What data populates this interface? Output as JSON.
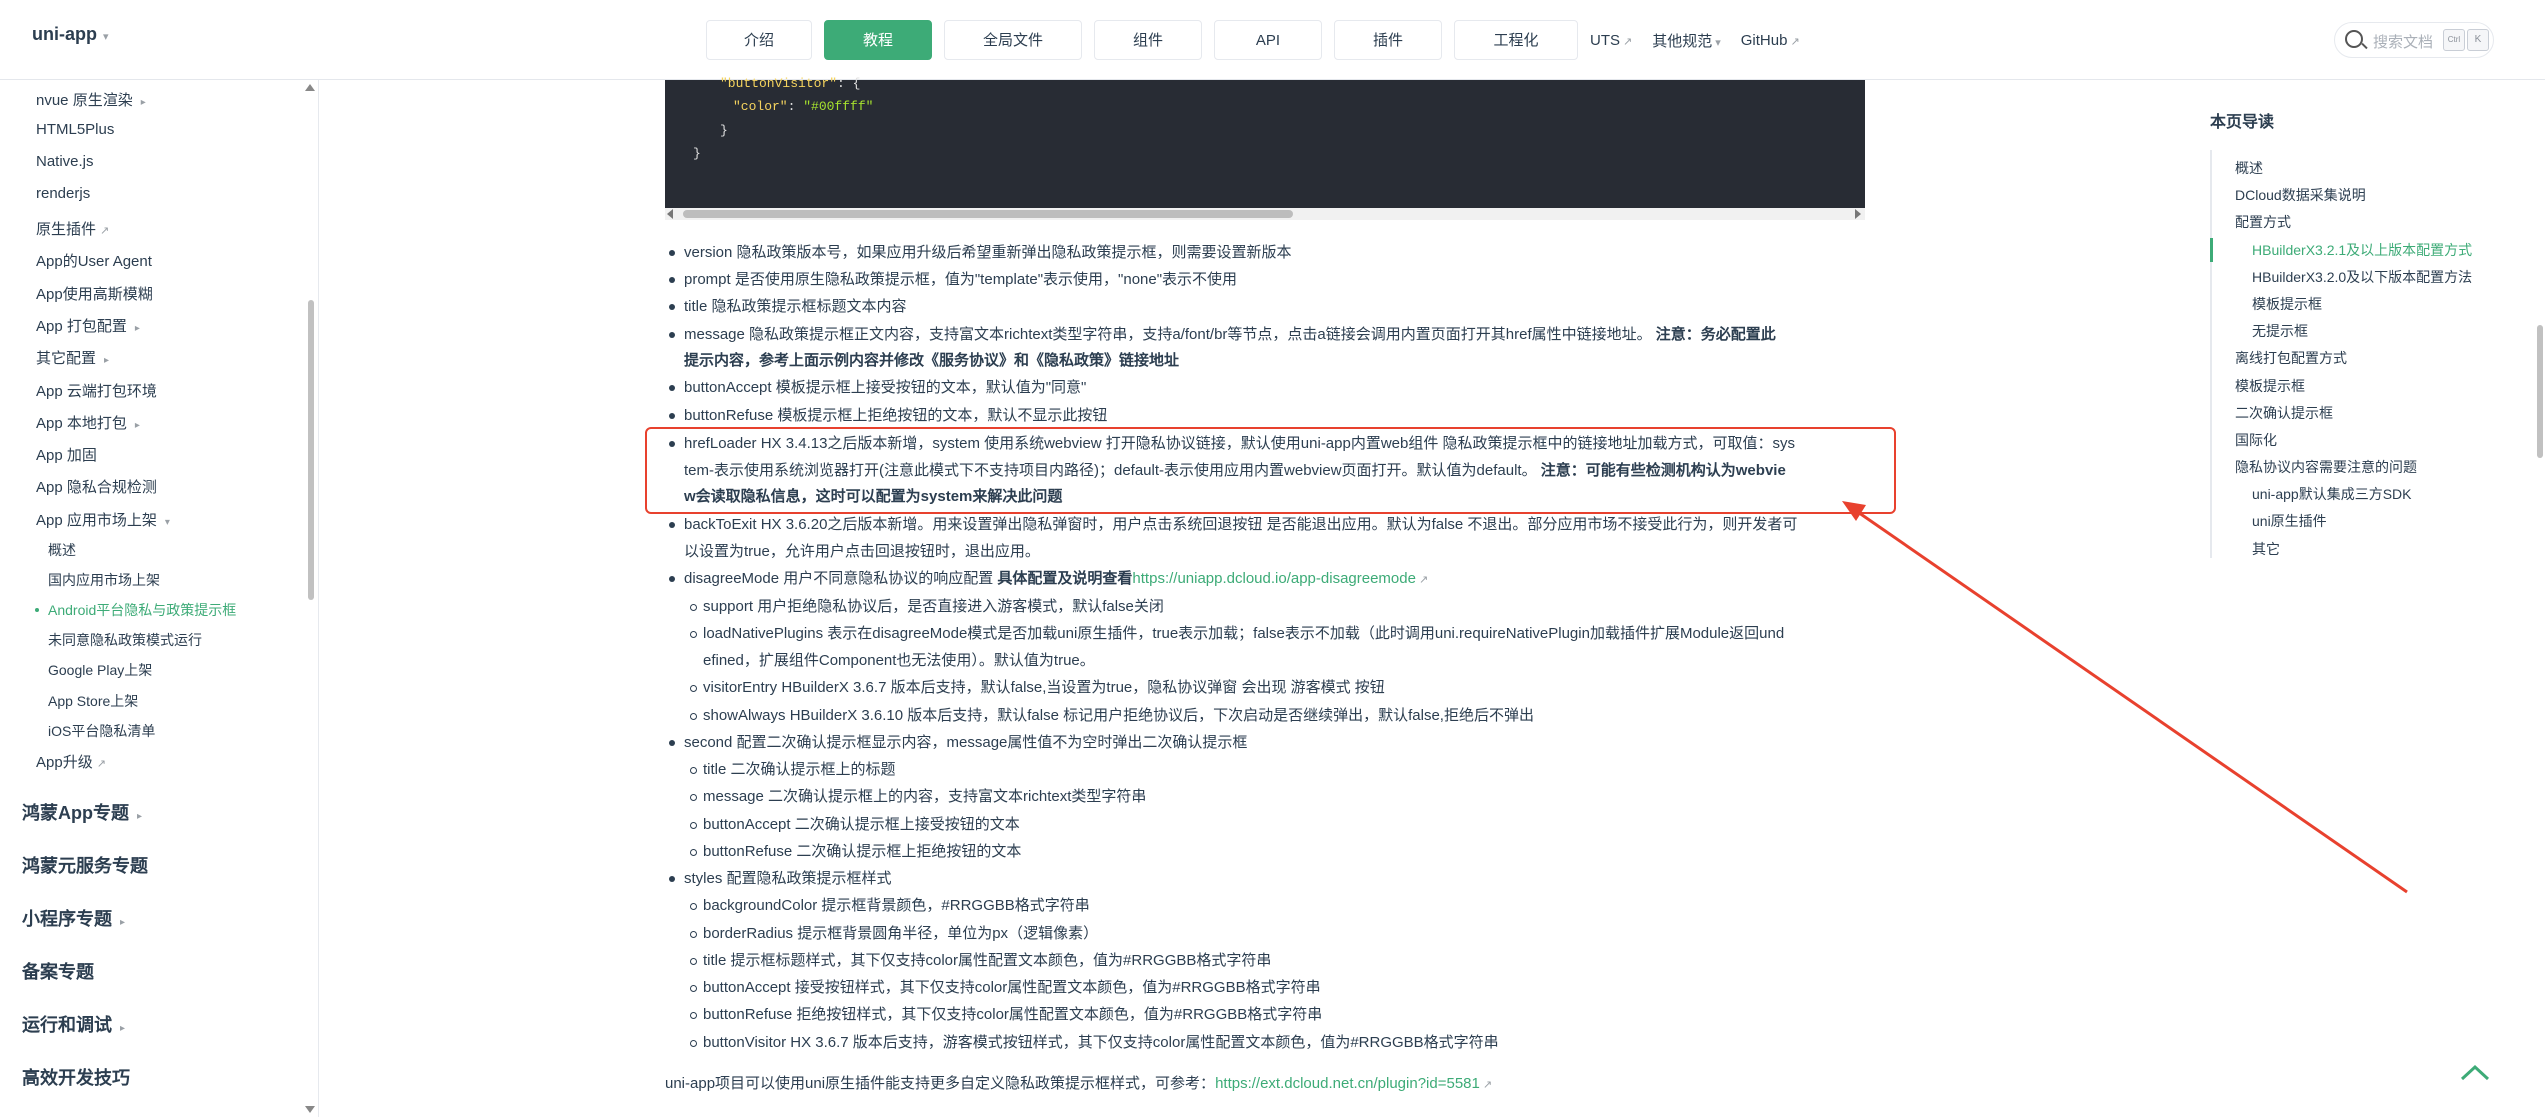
{
  "header": {
    "brand": "uni-app",
    "nav": [
      "介绍",
      "教程",
      "全局文件",
      "组件",
      "API",
      "插件",
      "工程化"
    ],
    "active_nav": "教程",
    "links": [
      "UTS",
      "其他规范",
      "GitHub"
    ],
    "search_placeholder": "搜索文档",
    "kbd1": "Ctrl",
    "kbd2": "K"
  },
  "sidebar": {
    "items": [
      "nvue 原生渲染",
      "HTML5Plus",
      "Native.js",
      "renderjs",
      "原生插件",
      "App的User Agent",
      "App使用高斯模糊",
      "App 打包配置",
      "其它配置",
      "App 云端打包环境",
      "App 本地打包",
      "App 加固",
      "App 隐私合规检测",
      "App 应用市场上架"
    ],
    "sub_items": [
      "概述",
      "国内应用市场上架",
      "Android平台隐私与政策提示框",
      "未同意隐私政策模式运行",
      "Google Play上架",
      "App Store上架",
      "iOS平台隐私清单"
    ],
    "app_upgrade": "App升级",
    "sections": [
      "鸿蒙App专题",
      "鸿蒙元服务专题",
      "小程序专题",
      "备案专题",
      "运行和调试",
      "高效开发技巧"
    ]
  },
  "code": {
    "line1_key": "\"buttonVisitor\"",
    "line1_rest": ": {",
    "line2_key": "\"color\"",
    "line2_sep": ": ",
    "line2_val": "\"#00ffff\"",
    "line3": "}",
    "line4": "}"
  },
  "content": {
    "l1": "version 隐私政策版本号，如果应用升级后希望重新弹出隐私政策提示框，则需要设置新版本",
    "l2": "prompt 是否使用原生隐私政策提示框，值为\"template\"表示使用，\"none\"表示不使用",
    "l3": "title 隐私政策提示框标题文本内容",
    "l4a": "message 隐私政策提示框正文内容，支持富文本richtext类型字符串，支持a/font/br等节点，点击a链接会调用内置页面打开其href属性中链接地址。",
    "l4b": "注意：务必配置此",
    "l4c": "提示内容，参考上面示例内容并修改《服务协议》和《隐私政策》链接地址",
    "l5": "buttonAccept 模板提示框上接受按钮的文本，默认值为\"同意\"",
    "l6": "buttonRefuse 模板提示框上拒绝按钮的文本，默认不显示此按钮",
    "l7a": "hrefLoader HX 3.4.13之后版本新增，system 使用系统webview 打开隐私协议链接，默认使用uni-app内置web组件 隐私政策提示框中的链接地址加载方式，可取值：sys",
    "l7b": "tem-表示使用系统浏览器打开(注意此模式下不支持项目内路径)；default-表示使用应用内置webview页面打开。默认值为default。",
    "l7c": "注意：可能有些检测机构认为webvie",
    "l7d": "w会读取隐私信息，这时可以配置为system来解决此问题",
    "l8a": "backToExit HX 3.6.20之后版本新增。用来设置弹出隐私弹窗时，用户点击系统回退按钮 是否能退出应用。默认为false 不退出。部分应用市场不接受此行为，则开发者可",
    "l8b": "以设置为true，允许用户点击回退按钮时，退出应用。",
    "l9a": "disagreeMode 用户不同意隐私协议的响应配置",
    "l9b": "具体配置及说明查看",
    "l9c": "https://uniapp.dcloud.io/app-disagreemode",
    "s1": "support 用户拒绝隐私协议后，是否直接进入游客模式，默认false关闭",
    "s2a": "loadNativePlugins 表示在disagreeMode模式是否加载uni原生插件，true表示加载；false表示不加载（此时调用uni.requireNativePlugin加载插件扩展Module返回und",
    "s2b": "efined，扩展组件Component也无法使用）。默认值为true。",
    "s3": "visitorEntry HBuilderX 3.6.7 版本后支持，默认false,当设置为true，隐私协议弹窗 会出现 游客模式 按钮",
    "s4": "showAlways HBuilderX 3.6.10 版本后支持，默认false 标记用户拒绝协议后，下次启动是否继续弹出，默认false,拒绝后不弹出",
    "l10": "second 配置二次确认提示框显示内容，message属性值不为空时弹出二次确认提示框",
    "t1": "title 二次确认提示框上的标题",
    "t2": "message 二次确认提示框上的内容，支持富文本richtext类型字符串",
    "t3": "buttonAccept 二次确认提示框上接受按钮的文本",
    "t4": "buttonRefuse 二次确认提示框上拒绝按钮的文本",
    "l11": "styles 配置隐私政策提示框样式",
    "u1": "backgroundColor 提示框背景颜色，#RRGGBB格式字符串",
    "u2": "borderRadius 提示框背景圆角半径，单位为px（逻辑像素）",
    "u3": "title 提示框标题样式，其下仅支持color属性配置文本颜色，值为#RRGGBB格式字符串",
    "u4": "buttonAccept 接受按钮样式，其下仅支持color属性配置文本颜色，值为#RRGGBB格式字符串",
    "u5": "buttonRefuse 拒绝按钮样式，其下仅支持color属性配置文本颜色，值为#RRGGBB格式字符串",
    "u6": "buttonVisitor HX 3.6.7 版本后支持，游客模式按钮样式，其下仅支持color属性配置文本颜色，值为#RRGGBB格式字符串",
    "footer_a": "uni-app项目可以使用uni原生插件能支持更多自定义隐私政策提示框样式，可参考：",
    "footer_link": "https://ext.dcloud.net.cn/plugin?id=5581"
  },
  "toc": {
    "title": "本页导读",
    "items": [
      "概述",
      "DCloud数据采集说明",
      "配置方式",
      "HBuilderX3.2.1及以上版本配置方式",
      "HBuilderX3.2.0及以下版本配置方法",
      "模板提示框",
      "无提示框",
      "离线打包配置方式",
      "模板提示框",
      "二次确认提示框",
      "国际化",
      "隐私协议内容需要注意的问题",
      "uni-app默认集成三方SDK",
      "uni原生插件",
      "其它"
    ]
  },
  "colors": {
    "accent": "#3dab77",
    "annotation": "#e8412e",
    "code_bg": "#282c34"
  }
}
